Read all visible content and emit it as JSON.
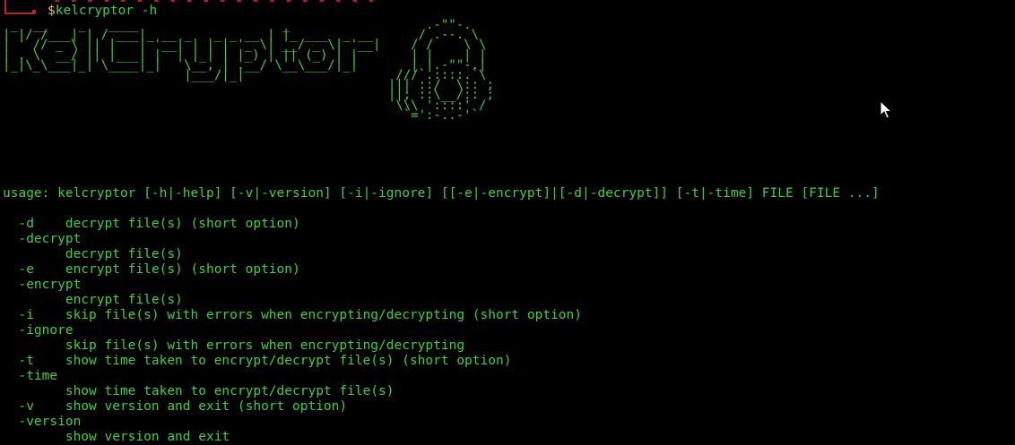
{
  "prompt": {
    "dollar": "$",
    "command": "kelcryptor -h"
  },
  "banner": {
    "ascii": " _  __    _   ____                   _                  .-\"\"-.\n| |/ /___| | / ___|_ __ _   _ _ __ | |_ ___  _ __      / .--. \\\n| ' // _ \\ || |   | '__| | | | '_ \\| __/ _ \\| '__|    / /    \\ \\\n| . \\  __/ || |___| |  | |_| | |_) | || (_) | |       | |    | |\n|_|\\_\\___|_| \\____|_|   \\__, | .__/ \\__\\___/|_|       | |.-\"\"-.|\n                        |___/|_|                    ///`.::::.`\\\n                                                   ||| ::/  \\:: ;\n                                                   ||; ::\\__/:: ;\n                                                    \\\\\\ '::::' /\n                                                     `=':-..-'`"
  },
  "usage": "usage: kelcryptor [-h|-help] [-v|-version] [-i|-ignore] [[-e|-encrypt]|[-d|-decrypt]] [-t|-time] FILE [FILE ...]",
  "help_lines": [
    "  -d    decrypt file(s) (short option)",
    "  -decrypt",
    "        decrypt file(s)",
    "  -e    encrypt file(s) (short option)",
    "  -encrypt",
    "        encrypt file(s)",
    "  -i    skip file(s) with errors when encrypting/decrypting (short option)",
    "  -ignore",
    "        skip file(s) with errors when encrypting/decrypting",
    "  -t    show time taken to encrypt/decrypt file(s) (short option)",
    "  -time",
    "        show time taken to encrypt/decrypt file(s)",
    "  -v    show version and exit (short option)",
    "  -version",
    "        show version and exit"
  ],
  "colors": {
    "background": "#000000",
    "text": "#3fd03f",
    "dollar": "#e8c840",
    "prompt_decor": "#c02020"
  },
  "icons": {
    "cursor": "mouse-pointer-icon"
  }
}
